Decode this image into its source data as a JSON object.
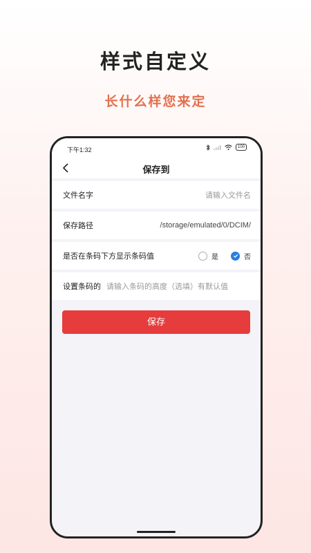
{
  "promo": {
    "title": "样式自定义",
    "subtitle": "长什么样您来定"
  },
  "status_bar": {
    "time": "下午1:32",
    "battery": "100"
  },
  "nav": {
    "title": "保存到"
  },
  "form": {
    "file_name": {
      "label": "文件名字",
      "placeholder": "请输入文件名"
    },
    "save_path": {
      "label": "保存路径",
      "value": "/storage/emulated/0/DCIM/"
    },
    "show_value": {
      "label": "是否在条码下方显示条码值",
      "option_yes": "是",
      "option_no": "否",
      "selected": "否"
    },
    "barcode_height": {
      "label": "设置条码的",
      "placeholder": "请输入条码的高度（选填）有默认值"
    }
  },
  "save_button": "保存",
  "colors": {
    "accent_red": "#e63c3c",
    "radio_blue": "#2a7de1",
    "subtitle_orange": "#e2704f"
  }
}
